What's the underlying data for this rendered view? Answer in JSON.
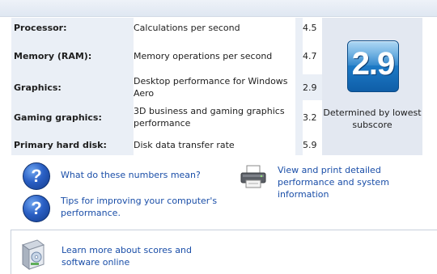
{
  "scores": {
    "rows": [
      {
        "component": "Processor:",
        "description": "Calculations per second",
        "subscore": "4.5"
      },
      {
        "component": "Memory (RAM):",
        "description": "Memory operations per second",
        "subscore": "4.7"
      },
      {
        "component": "Graphics:",
        "description": "Desktop performance for Windows Aero",
        "subscore": "2.9"
      },
      {
        "component": "Gaming graphics:",
        "description": "3D business and gaming graphics performance",
        "subscore": "3.2"
      },
      {
        "component": "Primary hard disk:",
        "description": "Disk data transfer rate",
        "subscore": "5.9"
      }
    ]
  },
  "base_score": {
    "value": "2.9",
    "caption": "Determined by lowest subscore"
  },
  "links": {
    "numbers_meaning": "What do these numbers mean?",
    "tips": "Tips for improving your computer's performance.",
    "print_info": "View and print detailed performance and system information",
    "learn_more": "Learn more about scores and software online"
  },
  "icons": {
    "help": "question-mark-icon",
    "printer": "printer-icon",
    "software": "software-box-icon"
  },
  "colors": {
    "panel_bg": "#eaeff6",
    "link": "#1a4ea8",
    "badge": "#1e7cc8"
  }
}
